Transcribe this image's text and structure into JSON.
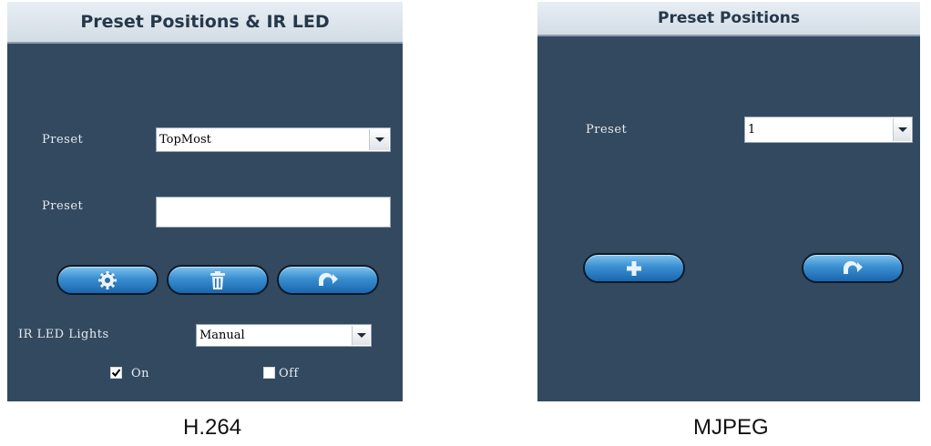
{
  "panels": {
    "h264": {
      "title": "Preset Positions & IR LED",
      "preset_select_label": "Preset",
      "preset_select_value": "TopMost",
      "preset_name_label": "Preset",
      "preset_name_value": "",
      "buttons": {
        "set_icon": "gear-icon",
        "delete_icon": "trash-icon",
        "goto_icon": "return-arrow-icon"
      },
      "ir_led_label": "IR LED Lights",
      "ir_led_mode": "Manual",
      "on_label": "On",
      "on_checked": true,
      "off_label": "Off",
      "off_checked": false,
      "caption": "H.264"
    },
    "mjpeg": {
      "title": "Preset Positions",
      "preset_select_label": "Preset",
      "preset_select_value": "1",
      "buttons": {
        "add_icon": "plus-icon",
        "goto_icon": "return-arrow-icon"
      },
      "caption": "MJPEG"
    }
  },
  "colors": {
    "panel_bg": "#334960",
    "button_blue": "#3a8fd0",
    "header_text": "#26384a"
  }
}
